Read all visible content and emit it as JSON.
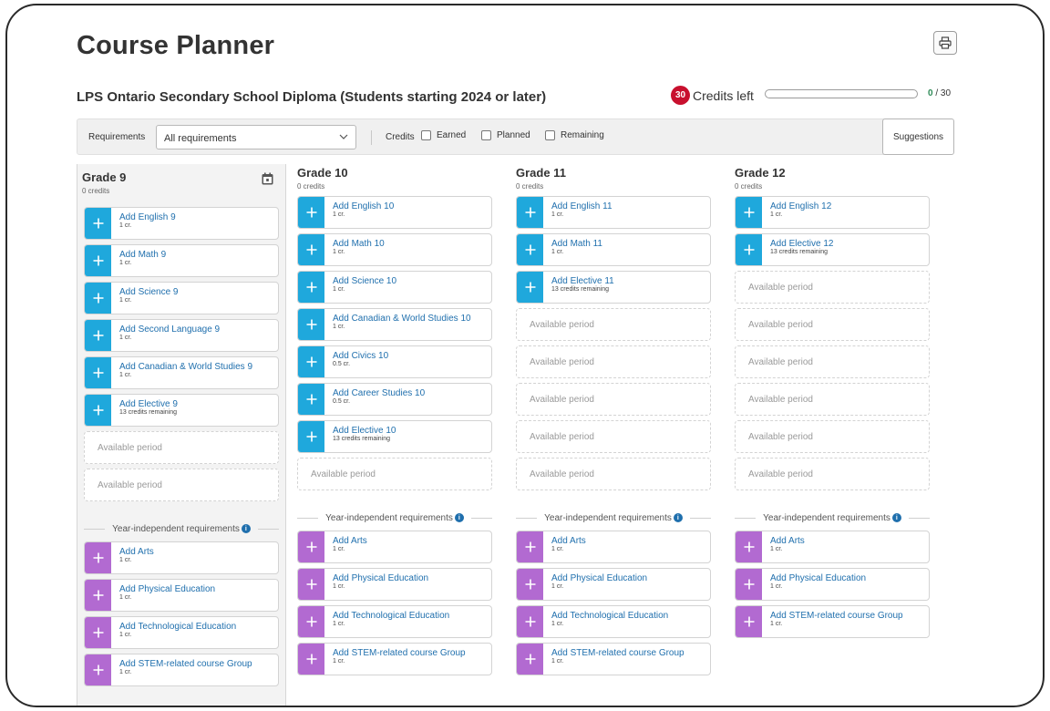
{
  "header": {
    "title": "Course Planner",
    "program": "LPS Ontario Secondary School Diploma (Students starting 2024 or later)",
    "credits_left_count": "30",
    "credits_left_label": "Credits left",
    "progress_earned": "0",
    "progress_total": "/ 30",
    "progress_fraction": 0
  },
  "filters": {
    "requirements_label": "Requirements",
    "requirements_value": "All requirements",
    "credits_label": "Credits",
    "earned_label": "Earned",
    "planned_label": "Planned",
    "remaining_label": "Remaining",
    "suggestions_label": "Suggestions"
  },
  "colors": {
    "add_button": "#1fa8dc",
    "independent_button": "#b26ad1",
    "badge": "#c8102e",
    "link": "#1f6fad"
  },
  "grades": [
    {
      "title": "Grade 9",
      "credits": "0 credits",
      "courses": [
        {
          "label": "Add English 9",
          "sub": "1 cr."
        },
        {
          "label": "Add Math 9",
          "sub": "1 cr."
        },
        {
          "label": "Add Science 9",
          "sub": "1 cr."
        },
        {
          "label": "Add Second Language 9",
          "sub": "1 cr."
        },
        {
          "label": "Add Canadian & World Studies 9",
          "sub": "1 cr."
        },
        {
          "label": "Add Elective 9",
          "sub": "13 credits remaining"
        }
      ],
      "available": [
        "Available period",
        "Available period"
      ],
      "independent_title": "Year-independent requirements",
      "independent": [
        {
          "label": "Add Arts",
          "sub": "1 cr."
        },
        {
          "label": "Add Physical Education",
          "sub": "1 cr."
        },
        {
          "label": "Add Technological Education",
          "sub": "1 cr."
        },
        {
          "label": "Add STEM-related course Group",
          "sub": "1 cr."
        }
      ]
    },
    {
      "title": "Grade 10",
      "credits": "0 credits",
      "courses": [
        {
          "label": "Add English 10",
          "sub": "1 cr."
        },
        {
          "label": "Add Math 10",
          "sub": "1 cr."
        },
        {
          "label": "Add Science 10",
          "sub": "1 cr."
        },
        {
          "label": "Add Canadian & World Studies 10",
          "sub": "1 cr."
        },
        {
          "label": "Add Civics 10",
          "sub": "0.5 cr."
        },
        {
          "label": "Add Career Studies 10",
          "sub": "0.5 cr."
        },
        {
          "label": "Add Elective 10",
          "sub": "13 credits remaining"
        }
      ],
      "available": [
        "Available period"
      ],
      "independent_title": "Year-independent requirements",
      "independent": [
        {
          "label": "Add Arts",
          "sub": "1 cr."
        },
        {
          "label": "Add Physical Education",
          "sub": "1 cr."
        },
        {
          "label": "Add Technological Education",
          "sub": "1 cr."
        },
        {
          "label": "Add STEM-related course Group",
          "sub": "1 cr."
        }
      ]
    },
    {
      "title": "Grade 11",
      "credits": "0 credits",
      "courses": [
        {
          "label": "Add English 11",
          "sub": "1 cr."
        },
        {
          "label": "Add Math 11",
          "sub": "1 cr."
        },
        {
          "label": "Add Elective 11",
          "sub": "13 credits remaining"
        }
      ],
      "available": [
        "Available period",
        "Available period",
        "Available period",
        "Available period",
        "Available period"
      ],
      "independent_title": "Year-independent requirements",
      "independent": [
        {
          "label": "Add Arts",
          "sub": "1 cr."
        },
        {
          "label": "Add Physical Education",
          "sub": "1 cr."
        },
        {
          "label": "Add Technological Education",
          "sub": "1 cr."
        },
        {
          "label": "Add STEM-related course Group",
          "sub": "1 cr."
        }
      ]
    },
    {
      "title": "Grade 12",
      "credits": "0 credits",
      "courses": [
        {
          "label": "Add English 12",
          "sub": "1 cr."
        },
        {
          "label": "Add Elective 12",
          "sub": "13 credits remaining"
        }
      ],
      "available": [
        "Available period",
        "Available period",
        "Available period",
        "Available period",
        "Available period",
        "Available period"
      ],
      "independent_title": "Year-independent requirements",
      "independent": [
        {
          "label": "Add Arts",
          "sub": "1 cr."
        },
        {
          "label": "Add Physical Education",
          "sub": "1 cr."
        },
        {
          "label": "Add STEM-related course Group",
          "sub": "1 cr."
        }
      ]
    }
  ]
}
